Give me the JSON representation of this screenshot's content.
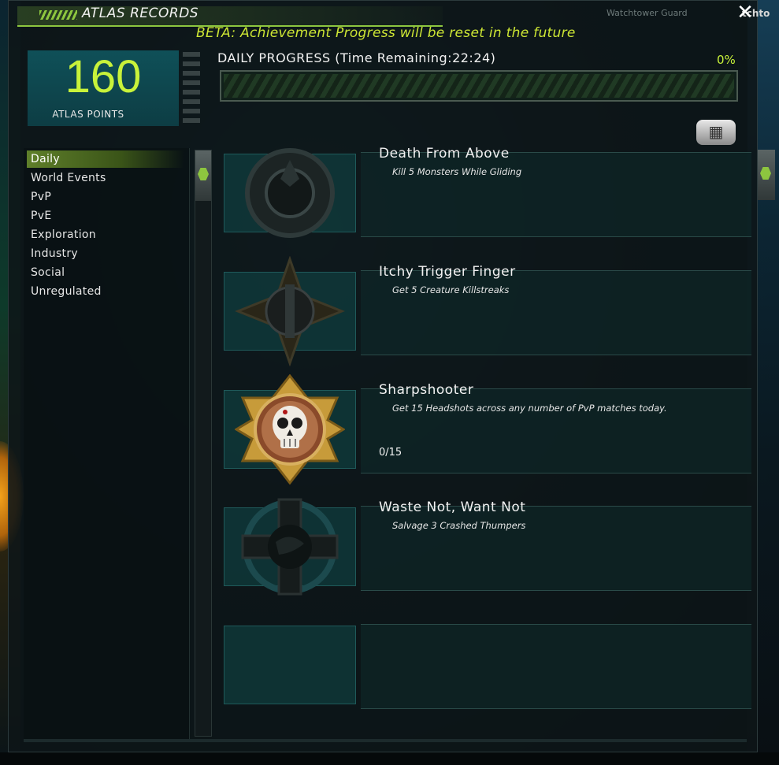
{
  "window": {
    "title": "ATLAS RECORDS",
    "top_tab_1": "Watchtower Guard",
    "top_tab_2": "tchto",
    "close_symbol": "✕"
  },
  "beta_notice": "BETA: Achievement Progress will be reset in the future",
  "atlas_points": {
    "value": "160",
    "label": "ATLAS POINTS"
  },
  "daily_progress": {
    "title": "DAILY PROGRESS (Time Remaining:22:24)",
    "percent_label": "0%",
    "fill_fraction": 0
  },
  "sidebar": {
    "items": [
      {
        "label": "Daily",
        "active": true
      },
      {
        "label": "World Events",
        "active": false
      },
      {
        "label": "PvP",
        "active": false
      },
      {
        "label": "PvE",
        "active": false
      },
      {
        "label": "Exploration",
        "active": false
      },
      {
        "label": "Industry",
        "active": false
      },
      {
        "label": "Social",
        "active": false
      },
      {
        "label": "Unregulated",
        "active": false
      }
    ]
  },
  "achievements": [
    {
      "title": "Death From Above",
      "description": "Kill 5 Monsters While Gliding",
      "progress": "",
      "icon": "shield-emblem-icon"
    },
    {
      "title": "Itchy Trigger Finger",
      "description": "Get 5 Creature Killstreaks",
      "progress": "",
      "icon": "spiked-star-emblem-icon"
    },
    {
      "title": "Sharpshooter",
      "description": "Get 15 Headshots across any number of PvP matches today.",
      "progress": "0/15",
      "icon": "skull-medal-icon"
    },
    {
      "title": "Waste Not, Want Not",
      "description": "Salvage 3 Crashed Thumpers",
      "progress": "",
      "icon": "globe-cross-emblem-icon"
    },
    {
      "title": "",
      "description": "",
      "progress": "",
      "icon": ""
    }
  ],
  "colors": {
    "accent_green": "#8dc63f",
    "points_green": "#c8f23a",
    "beta_yellow": "#cde634",
    "panel_teal": "#104a4a"
  }
}
